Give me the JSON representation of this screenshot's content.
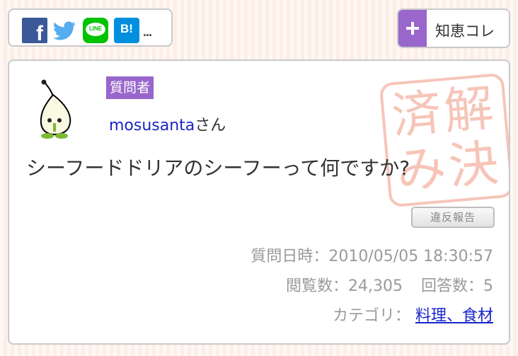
{
  "share": {
    "icons": [
      "facebook-icon",
      "twitter-icon",
      "line-icon",
      "hatena-bookmark-icon"
    ],
    "facebook_glyph": "f",
    "line_text": "LINE",
    "hatena_text": "B!",
    "more_text": "..."
  },
  "chiekore": {
    "plus_icon": "plus-icon",
    "label": "知恵コレ",
    "accent": "#9966cc"
  },
  "question": {
    "role": "質問者",
    "username": "mosusanta",
    "honorific": "さん",
    "title": "シーフードドリアのシーフーって何ですか?",
    "stamp_text": "解決済み",
    "report_label": "違反報告",
    "date_label": "質問日時：",
    "date_value": "2010/05/05 18:30:57",
    "views_label": "閲覧数：",
    "views_value": "24,305",
    "answers_label": "回答数：",
    "answers_value": "5",
    "category_label": "カテゴリ：",
    "category_value": "料理、食材"
  },
  "colors": {
    "accent": "#9966cc",
    "link": "#1a25c8",
    "stamp": "#f5b7a7",
    "background": "#fdeee6"
  }
}
